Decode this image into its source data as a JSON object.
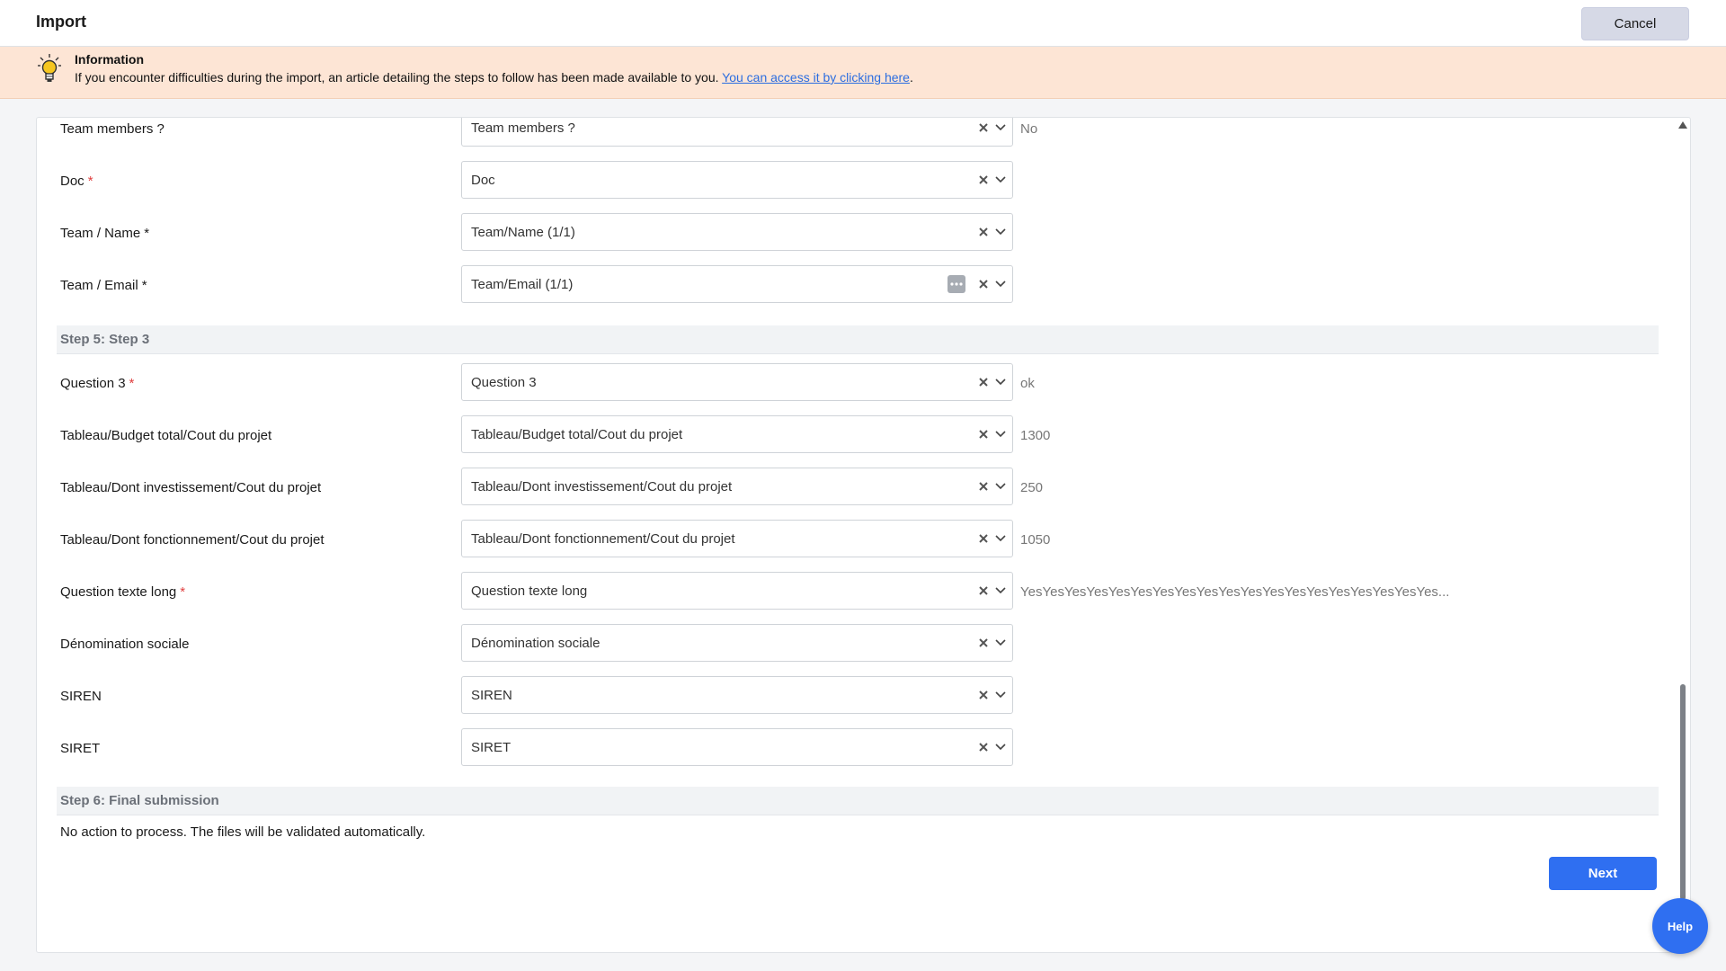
{
  "header": {
    "title": "Import",
    "cancel_label": "Cancel"
  },
  "info": {
    "title": "Information",
    "text": "If you encounter difficulties during the import, an article detailing the steps to follow has been made available to you. ",
    "link_text": "You can access it by clicking here",
    "suffix": ".",
    "icon": "lightbulb-icon"
  },
  "rows_top": [
    {
      "label": "Team members ?",
      "marker": "",
      "value": "Team members ?",
      "preview": "No"
    },
    {
      "label": "Doc",
      "marker": "*",
      "value": "Doc",
      "preview": ""
    },
    {
      "label": "Team / Name",
      "marker": "*",
      "value": "Team/Name (1/1)",
      "preview": ""
    },
    {
      "label": "Team / Email",
      "marker": "*",
      "value": "Team/Email (1/1)",
      "preview": ""
    }
  ],
  "step5": {
    "title": "Step 5: Step 3",
    "rows": [
      {
        "label": "Question 3",
        "marker": "*",
        "value": "Question 3",
        "preview": "ok"
      },
      {
        "label": "Tableau/Budget total/Cout du projet",
        "marker": "",
        "value": "Tableau/Budget total/Cout du projet",
        "preview": "1300"
      },
      {
        "label": "Tableau/Dont investissement/Cout du projet",
        "marker": "",
        "value": "Tableau/Dont investissement/Cout du projet",
        "preview": "250"
      },
      {
        "label": "Tableau/Dont fonctionnement/Cout du projet",
        "marker": "",
        "value": "Tableau/Dont fonctionnement/Cout du projet",
        "preview": "1050"
      },
      {
        "label": "Question texte long",
        "marker": "*",
        "value": "Question texte long",
        "preview": "YesYesYesYesYesYesYesYesYesYesYesYesYesYesYesYesYesYesYes..."
      },
      {
        "label": "Dénomination sociale",
        "marker": "",
        "value": "Dénomination sociale",
        "preview": ""
      },
      {
        "label": "SIREN",
        "marker": "",
        "value": "SIREN",
        "preview": ""
      },
      {
        "label": "SIRET",
        "marker": "",
        "value": "SIRET",
        "preview": ""
      }
    ]
  },
  "step6": {
    "title": "Step 6: Final submission",
    "text": "No action to process. The files will be validated automatically."
  },
  "actions": {
    "next_label": "Next",
    "help_label": "Help"
  },
  "colors": {
    "accent": "#2f6ff1",
    "banner": "#fde5d5",
    "required": "#e03e3e"
  }
}
